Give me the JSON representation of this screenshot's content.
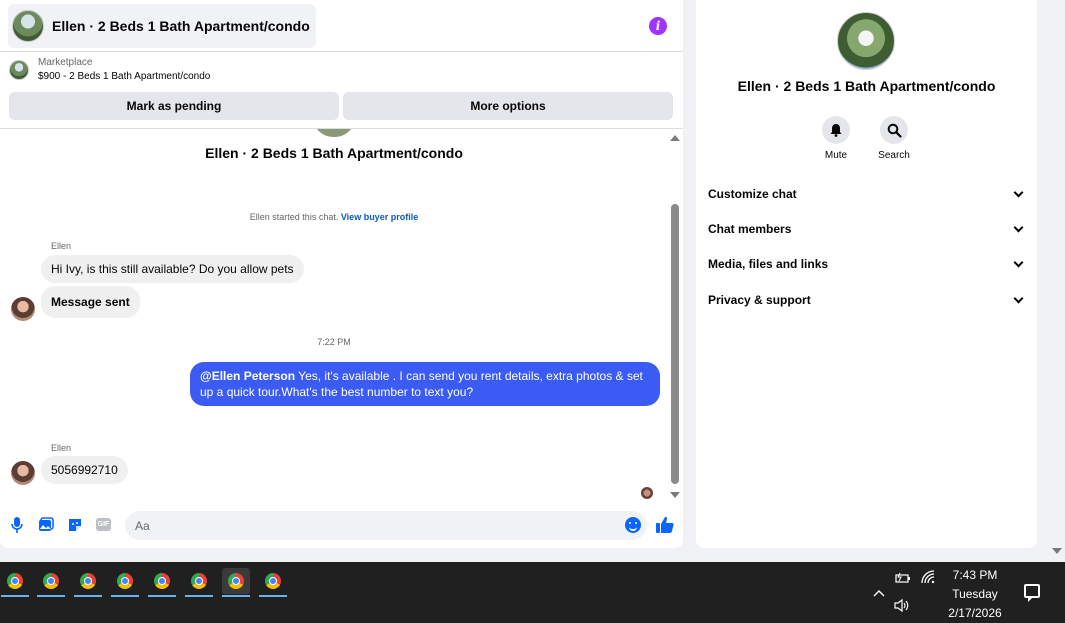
{
  "header": {
    "title": "Ellen · 2 Beds 1 Bath Apartment/condo"
  },
  "listing": {
    "label": "Marketplace",
    "summary": "$900 - 2 Beds 1 Bath Apartment/condo"
  },
  "actions": {
    "mark_pending": "Mark as pending",
    "more_options": "More options"
  },
  "thread": {
    "title": "Ellen · 2 Beds 1 Bath Apartment/condo",
    "started_text": "Ellen started this chat.",
    "view_profile": "View buyer profile",
    "messages": [
      {
        "sender": "Ellen",
        "text": "Hi Ivy, is this still available? Do you allow pets"
      },
      {
        "text": "Message sent"
      },
      {
        "time": "7:22 PM"
      },
      {
        "mention": "@Ellen Peterson",
        "text": " Yes, it's available .  I can send you rent details, extra photos & set up a quick tour.What's the best number to text you?"
      },
      {
        "sender": "Ellen",
        "text": "5056992710"
      }
    ]
  },
  "composer": {
    "placeholder": "Aa"
  },
  "side": {
    "title": "Ellen · 2 Beds 1 Bath Apartment/condo",
    "mute_label": "Mute",
    "search_label": "Search",
    "sections": [
      "Customize chat",
      "Chat members",
      "Media, files and links",
      "Privacy & support"
    ]
  },
  "taskbar": {
    "apps": [
      "chrome-icon",
      "chrome-icon",
      "chrome-icon",
      "chrome-icon",
      "chrome-icon",
      "chrome-icon",
      "chrome-icon",
      "chrome-icon"
    ],
    "time": "7:43 PM",
    "day": "Tuesday",
    "date": "2/17/2026"
  },
  "colors": {
    "accent": "#0866ff",
    "outgoing_bubble": "#3b5bf5",
    "info": "#a033ff"
  }
}
